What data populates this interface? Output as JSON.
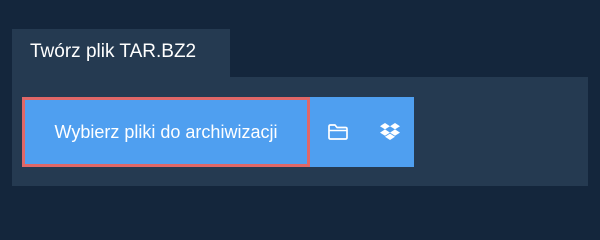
{
  "tab": {
    "title": "Twórz plik TAR.BZ2"
  },
  "uploader": {
    "choose_label": "Wybierz pliki do archiwizacji",
    "folder_icon": "folder-icon",
    "dropbox_icon": "dropbox-icon"
  },
  "colors": {
    "background": "#14263c",
    "panel": "#253a51",
    "button": "#4f9ff0",
    "highlight_border": "#e06767",
    "text": "#ffffff"
  }
}
